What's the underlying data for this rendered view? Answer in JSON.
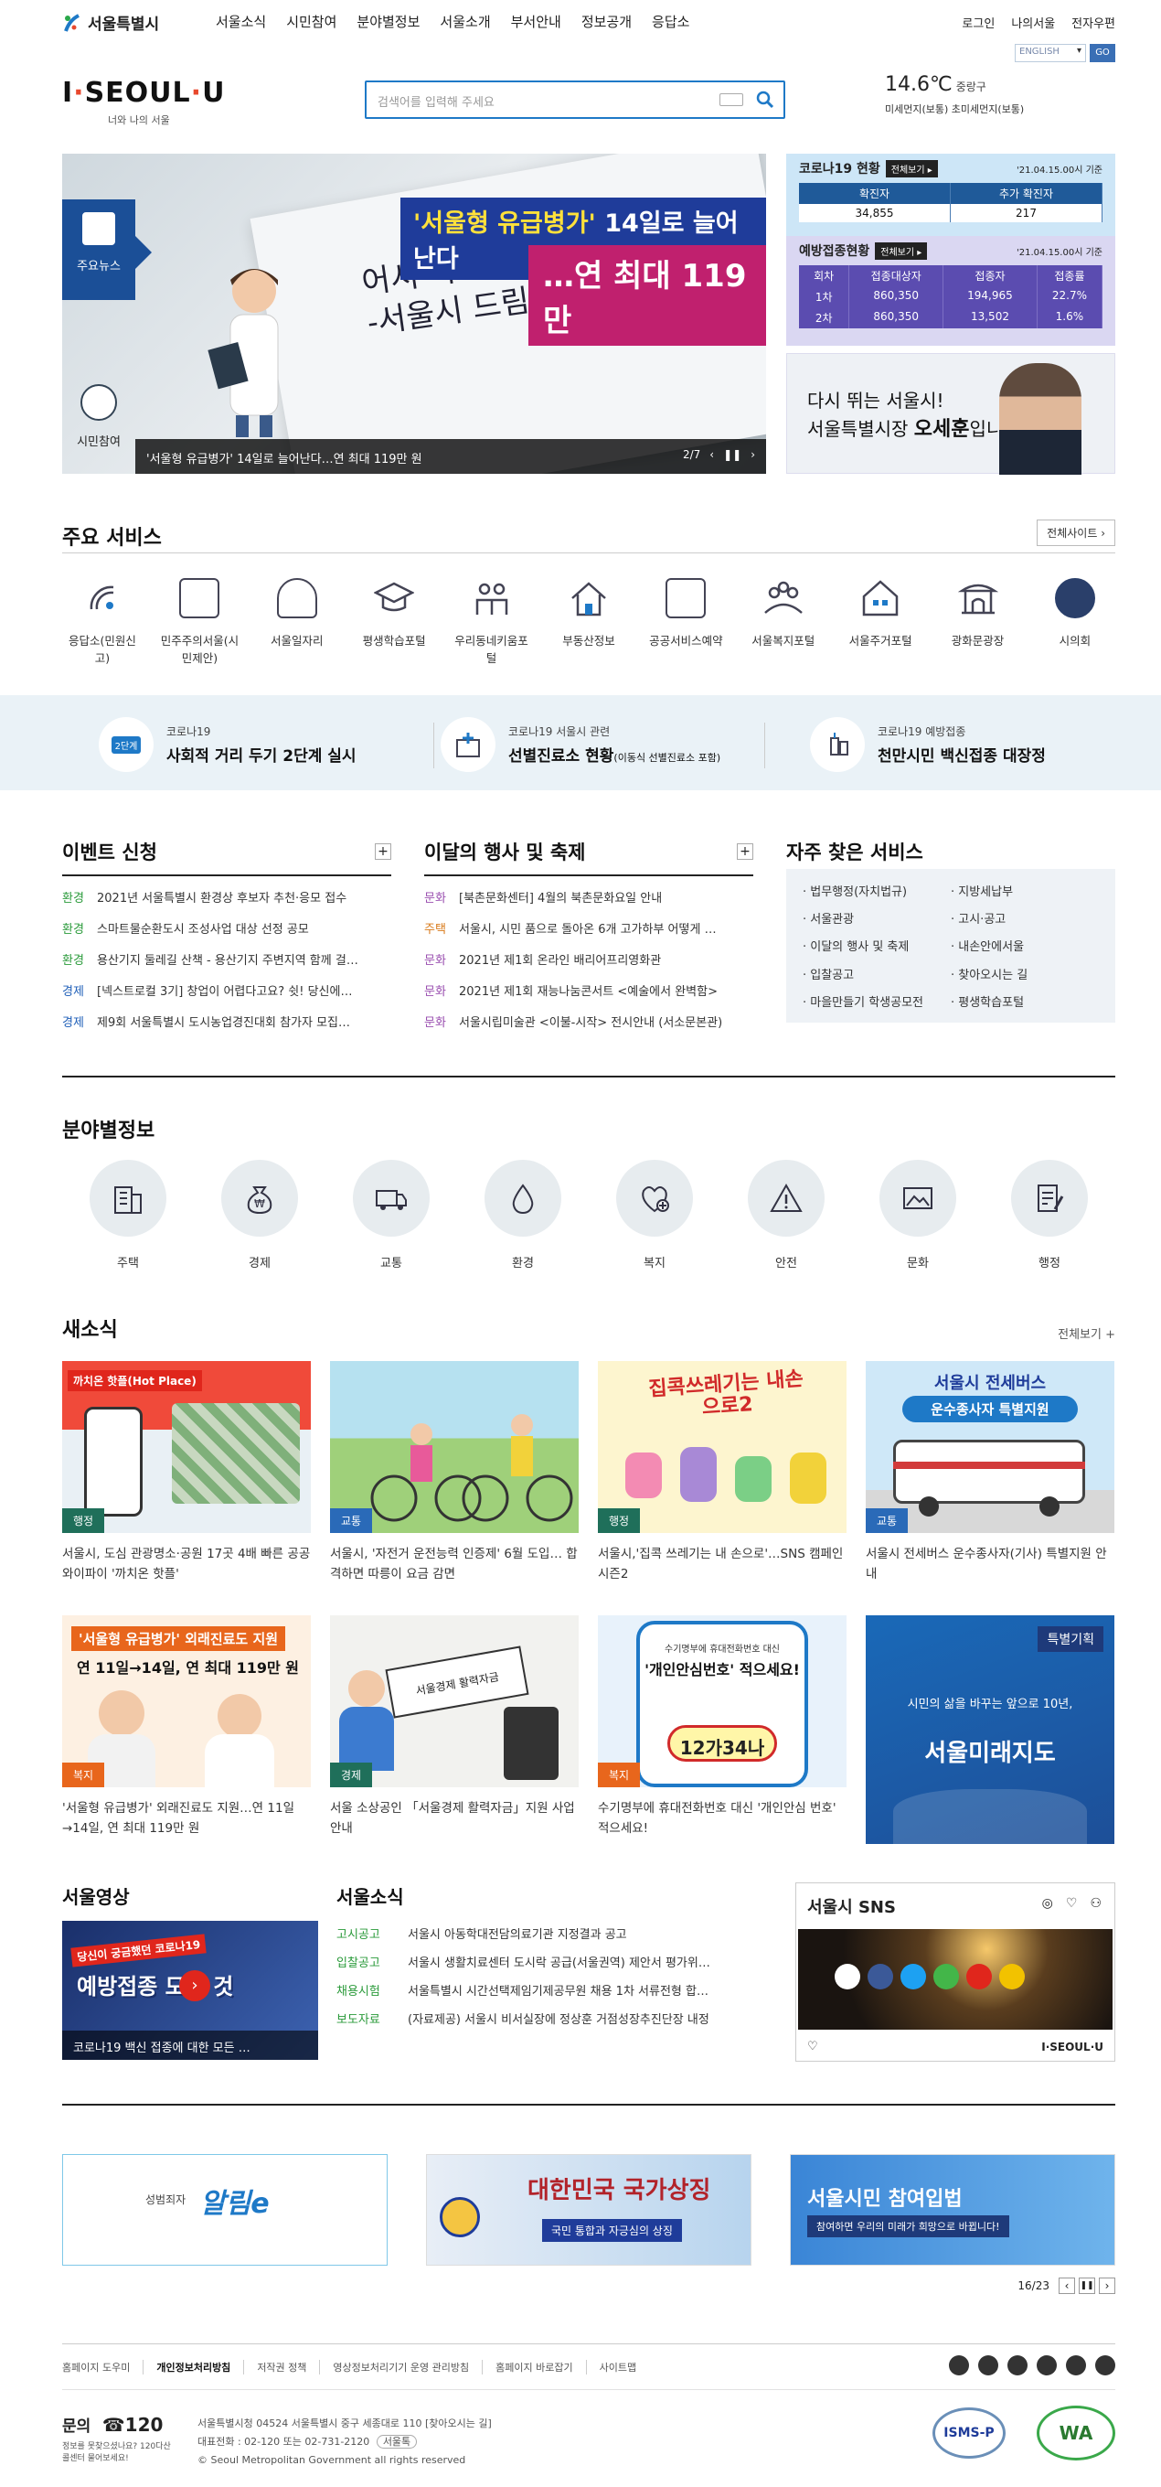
{
  "gnb": {
    "brand": "서울특별시",
    "menu": [
      "서울소식",
      "시민참여",
      "분야별정보",
      "서울소개",
      "부서안내",
      "정보공개",
      "응답소"
    ],
    "util": [
      "로그인",
      "나의서울",
      "전자우편"
    ],
    "language": "ENGLISH",
    "go": "GO"
  },
  "header": {
    "logo": "I·SEOUL·U",
    "logo_sub": "너와 나의 서울",
    "search_placeholder": "검색어를 입력해 주세요",
    "temp": "14.6℃",
    "location": "중랑구",
    "dust": "미세먼지(보통) 초미세먼지(보통)"
  },
  "banner": {
    "tab_news": "주요뉴스",
    "tab_part": "시민참여",
    "headline1_pre": "'서울형 유급병가'",
    "headline1_post": " 14일로 늘어난다",
    "headline2": "…연 최대 119만",
    "hand_text": "어서 나으세요!\n-서울시 드림-",
    "caption": "'서울형 유급병가' 14일로 늘어난다…연 최대 119만 원",
    "counter": "2/7"
  },
  "covid": {
    "title": "코로나19 현황",
    "all_btn": "전체보기",
    "date": "'21.04.15.00시 기준",
    "headers": [
      "확진자",
      "추가 확진자"
    ],
    "values": [
      "34,855",
      "217"
    ],
    "vac_title": "예방접종현황",
    "vac_all_btn": "전체보기",
    "vac_date": "'21.04.15.00시 기준",
    "vac_headers": [
      "회차",
      "접종대상자",
      "접종자",
      "접종률"
    ],
    "vac_rows": [
      [
        "1차",
        "860,350",
        "194,965",
        "22.7%"
      ],
      [
        "2차",
        "860,350",
        "13,502",
        "1.6%"
      ]
    ]
  },
  "mayor": {
    "line1": "다시 뛰는 서울시!",
    "line2_a": "서울특별시장 ",
    "line2_b": "오세훈",
    "line2_c": "입니다."
  },
  "services": {
    "title": "주요 서비스",
    "all_site": "전체사이트",
    "items": [
      "응답소(민원신고)",
      "민주주의서울(시민제안)",
      "서울일자리",
      "평생학습포털",
      "우리동네키움포털",
      "부동산정보",
      "공공서비스예약",
      "서울복지포털",
      "서울주거포털",
      "광화문광장",
      "시의회"
    ]
  },
  "strip": [
    {
      "small": "코로나19",
      "big": "사회적 거리 두기 2단계 실시",
      "note": "",
      "badge": "2단계"
    },
    {
      "small": "코로나19 서울시 관련",
      "big": "선별진료소 현황",
      "note": "(이동식 선별진료소 포함)"
    },
    {
      "small": "코로나19 예방접종",
      "big": "천만시민 백신접종 대장정",
      "note": ""
    }
  ],
  "events": {
    "title": "이벤트 신청",
    "items": [
      {
        "tag": "환경",
        "text": "2021년 서울특별시 환경상 후보자 추천·응모 접수"
      },
      {
        "tag": "환경",
        "text": "스마트물순환도시 조성사업 대상 선정 공모"
      },
      {
        "tag": "환경",
        "text": "용산기지 둘레길 산책 - 용산기지 주변지역 함께 걸…"
      },
      {
        "tag": "경제",
        "text": "[넥스트로컬 3기] 창업이 어렵다고요? 쉿! 당신에…"
      },
      {
        "tag": "경제",
        "text": "제9회 서울특별시 도시농업경진대회 참가자 모집…"
      }
    ]
  },
  "festivals": {
    "title": "이달의 행사 및 축제",
    "items": [
      {
        "tag": "문화",
        "text": "[북촌문화센터] 4월의 북촌문화요일 안내"
      },
      {
        "tag": "주택",
        "text": "서울시, 시민 품으로 돌아온 6개 고가하부 어떻게 …"
      },
      {
        "tag": "문화",
        "text": "2021년 제1회 온라인 배리어프리영화관"
      },
      {
        "tag": "문화",
        "text": "2021년 제1회 재능나눔콘서트 <예술에서 완벽함>"
      },
      {
        "tag": "문화",
        "text": "서울시립미술관 <이불-시작> 전시안내 (서소문본관)"
      }
    ]
  },
  "faq": {
    "title": "자주 찾은 서비스",
    "items": [
      "법무행정(자치법규)",
      "지방세납부",
      "서울관광",
      "고시·공고",
      "이달의 행사 및 축제",
      "내손안에서울",
      "입찰공고",
      "찾아오시는 길",
      "마을만들기 학생공모전",
      "평생학습포털"
    ]
  },
  "field": {
    "title": "분야별정보",
    "items": [
      "주택",
      "경제",
      "교통",
      "환경",
      "복지",
      "안전",
      "문화",
      "행정"
    ]
  },
  "news": {
    "title": "새소식",
    "all": "전체보기",
    "items": [
      {
        "badge": "행정",
        "title": "서울시, 도심 관광명소·공원 17곳 4배 빠른 공공와이파이 '까치온 핫플'",
        "img_text": "까치온 핫플(Hot Place)"
      },
      {
        "badge": "교통",
        "title": "서울시, '자전거 운전능력 인증제' 6월 도입… 합격하면 따릉이 요금 감면",
        "img_text": ""
      },
      {
        "badge": "행정",
        "title": "서울시,'집콕 쓰레기는 내 손으로'…SNS 캠페인 시즌2",
        "img_text": "집콕쓰레기는 내손으로2"
      },
      {
        "badge": "교통",
        "title": "서울시 전세버스 운수종사자(기사) 특별지원 안내",
        "img_text": "서울시 전세버스",
        "img_text2": "운수종사자 특별지원"
      },
      {
        "badge": "복지",
        "title": "'서울형 유급병가' 외래진료도 지원…연 11일→14일, 연 최대 119만 원",
        "img_text": "'서울형 유급병가' 외래진료도 지원",
        "img_text2": "연 11일→14일, 연 최대 119만 원"
      },
      {
        "badge": "경제",
        "title": "서울 소상공인 「서울경제 활력자금」지원 사업 안내",
        "img_text": "서울경제 활력자금"
      },
      {
        "badge": "복지",
        "title": "수기명부에 휴대전화번호 대신 '개인안심 번호' 적으세요!",
        "img_text": "'개인안심번호' 적으세요!",
        "img_text2": "12가34나",
        "img_text3": "수기명부에 휴대전화번호 대신"
      },
      {
        "badge": "",
        "title": "",
        "img_text": "특별기획",
        "img_text2": "시민의 삶을 바꾸는 앞으로 10년,",
        "img_text3": "서울미래지도"
      }
    ]
  },
  "video": {
    "title": "서울영상",
    "caption": "코로나19 백신 접종에 대한 모든 …",
    "top_text": "당신이 궁금했던 코로나19",
    "main_text": "예방접종 모든 것"
  },
  "seoul_news": {
    "title": "서울소식",
    "items": [
      {
        "tag": "고시공고",
        "text": "서울시 아동학대전담의료기관 지정결과 공고"
      },
      {
        "tag": "입찰공고",
        "text": "서울시 생활치료센터 도시락 공급(서울권역) 제안서 평가위…"
      },
      {
        "tag": "채용시험",
        "text": "서울특별시 시간선택제임기제공무원 채용 1차 서류전형 합…"
      },
      {
        "tag": "보도자료",
        "text": "(자료제공) 서울시 비서실장에 정상훈 거점성장추진단장 내정"
      }
    ]
  },
  "sns": {
    "title": "서울시 SNS",
    "logo": "I·SEOUL·U"
  },
  "bottom_banners": [
    {
      "text": "알림e",
      "sub": "성범죄자"
    },
    {
      "text": "대한민국 국가상징",
      "sub": "국민 통합과 자긍심의 상징"
    },
    {
      "text": "서울시민 참여입법",
      "sub": "참여하면 우리의 미래가 희망으로 바뀝니다!"
    }
  ],
  "banner_counter": "16/23",
  "footer": {
    "links": [
      "홈페이지 도우미",
      "개인정보처리방침",
      "저작권 정책",
      "영상정보처리기기 운영 관리방침",
      "홈페이지 바로잡기",
      "사이트맵"
    ],
    "inquiry": "문의",
    "phone": "☎120",
    "phone_sub": "정보를 못찾으셨나요? 120다산콜센터 물어보세요!",
    "address": "서울특별시청 04524 서울특별시 중구 세종대로 110 [찾아오시는 길]",
    "tel": "대표전화 : 02-120 또는 02-731-2120",
    "badge": "서울톡",
    "copy": "© Seoul Metropolitan Government all rights reserved",
    "cert1": "ISMS-P",
    "cert2": "WA"
  }
}
